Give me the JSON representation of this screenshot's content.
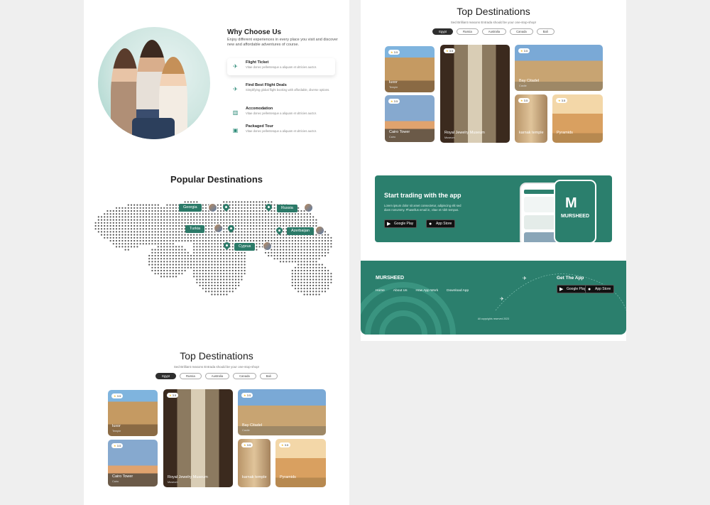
{
  "why": {
    "title": "Why Choose Us",
    "subtitle": "Enjoy different experiences in every place you visit and discover new and affordable adventures of course.",
    "features": [
      {
        "title": "Flight Ticket",
        "desc": "Vitae donec pellentesque a aliquam et ultricies auctor."
      },
      {
        "title": "Find Best Flight Deals",
        "desc": "Simplifying global flight booking with affordable, diverse options."
      },
      {
        "title": "Accomodation",
        "desc": "Vitae donec pellentesque a aliquam et ultricies auctor."
      },
      {
        "title": "Packaged Tour",
        "desc": "Vitae donec pellentesque a aliquam et ultricies auctor."
      }
    ]
  },
  "popular": {
    "title": "Popular Destinations",
    "pins": [
      "Georgia",
      "Russia",
      "Turkia",
      "Azerbaijan",
      "Cyprus"
    ]
  },
  "top": {
    "title": "Top Destinations",
    "subtitle": "Sed Brilliant reasons Entrada should be your one-stop-shop!",
    "chips": [
      "Egypt",
      "Russia",
      "Australia",
      "Canada",
      "Bali"
    ],
    "cards": [
      {
        "rating": "3.5",
        "name": "luxor",
        "sub": "Temple"
      },
      {
        "rating": "3.5",
        "name": "Cairo Tower",
        "sub": "Cairo"
      },
      {
        "rating": "3.5",
        "name": "Royal Jewelry Museum",
        "sub": "Museum"
      },
      {
        "rating": "3.5",
        "name": "Bay Citadel",
        "sub": "Castle"
      },
      {
        "rating": "3.5",
        "name": "karnak temple",
        "sub": ""
      },
      {
        "rating": "3.5",
        "name": "Pyramids",
        "sub": ""
      }
    ]
  },
  "banner": {
    "title": "Start trading with the app",
    "desc": "Lorem ipsum dolor sit amet consectetur, adipiscing elit sed diam nonummy. Phasellus email in, vitae et nibh tempus.",
    "google": "Google Play",
    "apple": "App Store",
    "phone_brand": "MURSHEED"
  },
  "footer": {
    "brand": "MURSHEED",
    "links": [
      "Home",
      "About Us",
      "How App Work",
      "Download App"
    ],
    "get_app": "Get The App",
    "google": "Google Play",
    "apple": "App Store",
    "copyright": "All copyrights reserved 2023"
  },
  "colors": {
    "accent": "#2b7f6d",
    "chip_active": "#2e2e2e",
    "star": "#f2b71c"
  }
}
